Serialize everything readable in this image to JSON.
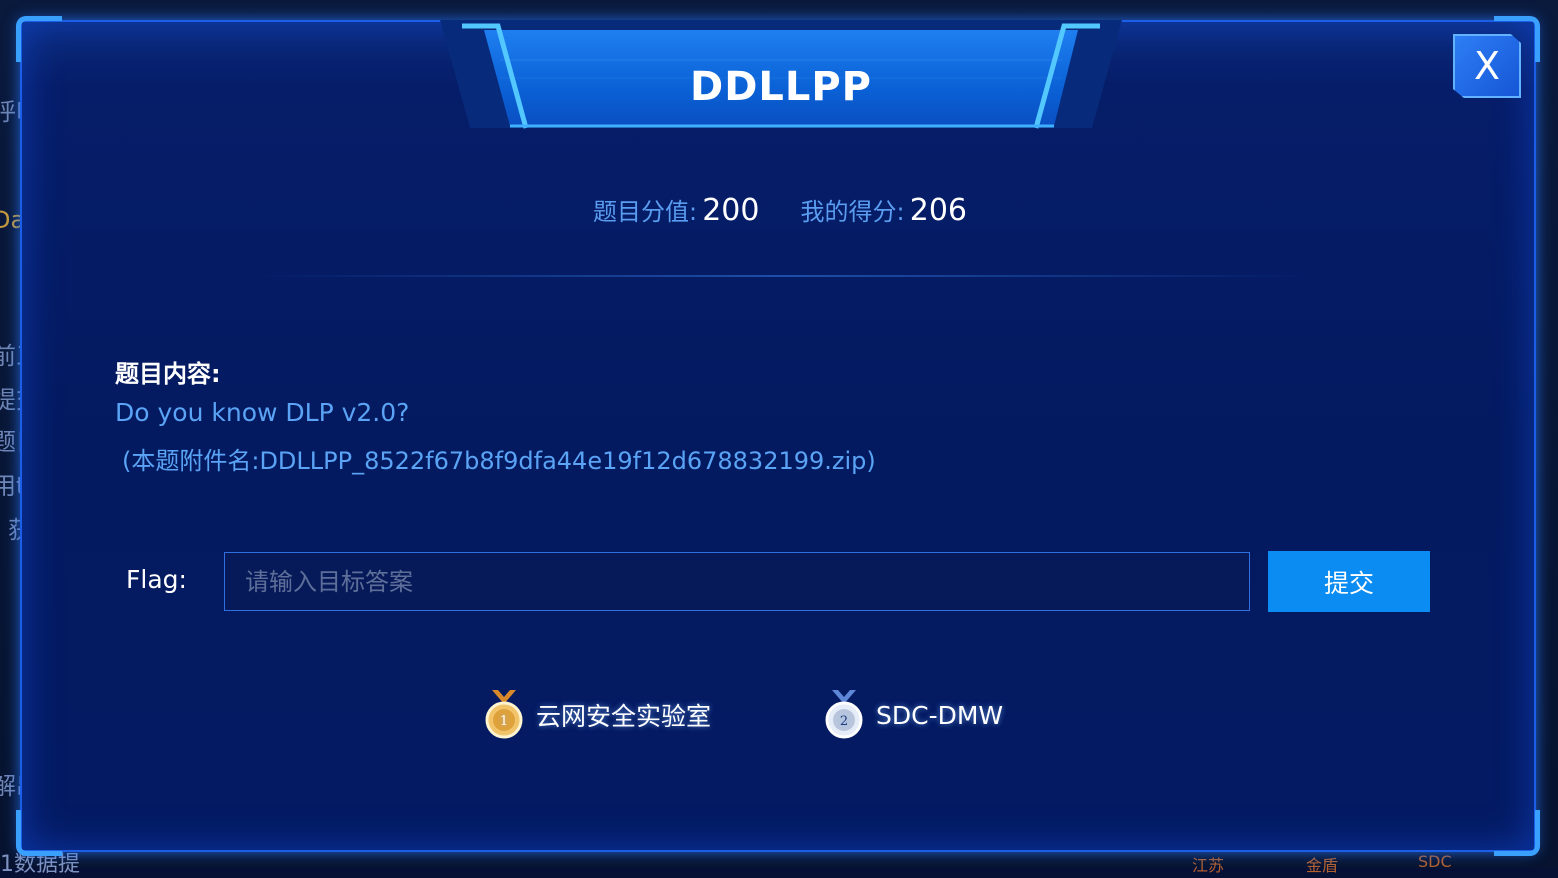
{
  "background": {
    "left_fragments": [
      "呼叫",
      "Daa",
      "前三",
      "提交",
      "题目",
      "用t",
      "获",
      "解出"
    ],
    "bottom_left": "1数据提",
    "bottom_right": [
      "江苏",
      "金盾",
      "SDC"
    ]
  },
  "modal": {
    "title": "DDLLPP",
    "close_label": "X",
    "score": {
      "points_label": "题目分值:",
      "points_value": "200",
      "my_score_label": "我的得分:",
      "my_score_value": "206"
    },
    "content": {
      "heading": "题目内容:",
      "description": "Do you know DLP v2.0?",
      "attachment": "(本题附件名:DDLLPP_8522f67b8f9dfa44e19f12d678832199.zip)"
    },
    "flag": {
      "label": "Flag:",
      "value": "",
      "placeholder": "请输入目标答案",
      "submit_label": "提交"
    },
    "solvers": [
      {
        "rank": "1",
        "name": "云网安全实验室",
        "medal_color": "#e0a23a",
        "icon": "gold-medal-icon"
      },
      {
        "rank": "2",
        "name": "SDC-DMW",
        "medal_color": "#b9c6dc",
        "icon": "silver-medal-icon"
      }
    ]
  },
  "colors": {
    "accent": "#0b8cf2",
    "label_blue": "#5a9cf0",
    "modal_bg": "#041a60"
  }
}
